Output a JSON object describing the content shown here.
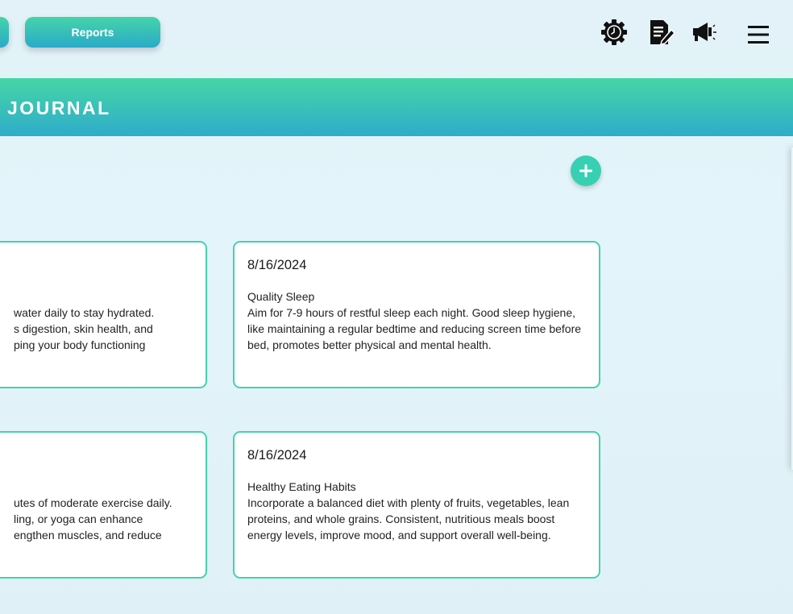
{
  "topbar": {
    "prev_button_label": "",
    "reports_button_label": "Reports",
    "icons": [
      "gear-clock-icon",
      "document-edit-icon",
      "megaphone-icon",
      "hamburger-menu-icon"
    ]
  },
  "header": {
    "title": "JOURNAL"
  },
  "add_button": {
    "icon": "plus-icon",
    "label": "+"
  },
  "colors": {
    "accent_green": "#46d6a6",
    "accent_blue": "#2eacca",
    "card_border": "#46d1ae",
    "add_button": "#37d0b2",
    "background": "#e3f5fa"
  },
  "entries": [
    {
      "date": "",
      "title": "",
      "body": "water daily to stay hydrated. s digestion, skin health, and ping your body functioning",
      "lines": [
        "",
        "",
        "water daily to stay hydrated.",
        "s digestion, skin health, and",
        "ping your body functioning"
      ]
    },
    {
      "date": "8/16/2024",
      "title": "Quality Sleep",
      "body": "Aim for 7-9 hours of restful sleep each night. Good sleep hygiene, like maintaining a regular bedtime and reducing screen time before bed, promotes better physical and mental health."
    },
    {
      "date": "",
      "title": "",
      "body": "utes of moderate exercise daily. ling, or yoga can enhance engthen muscles, and reduce",
      "lines": [
        "",
        "",
        "utes of moderate exercise daily.",
        "ling, or yoga can enhance",
        "engthen muscles, and reduce"
      ]
    },
    {
      "date": "8/16/2024",
      "title": "Healthy Eating Habits",
      "body": "Incorporate a balanced diet with plenty of fruits, vegetables, lean proteins, and whole grains. Consistent, nutritious meals boost energy levels, improve mood, and support overall well-being."
    }
  ]
}
